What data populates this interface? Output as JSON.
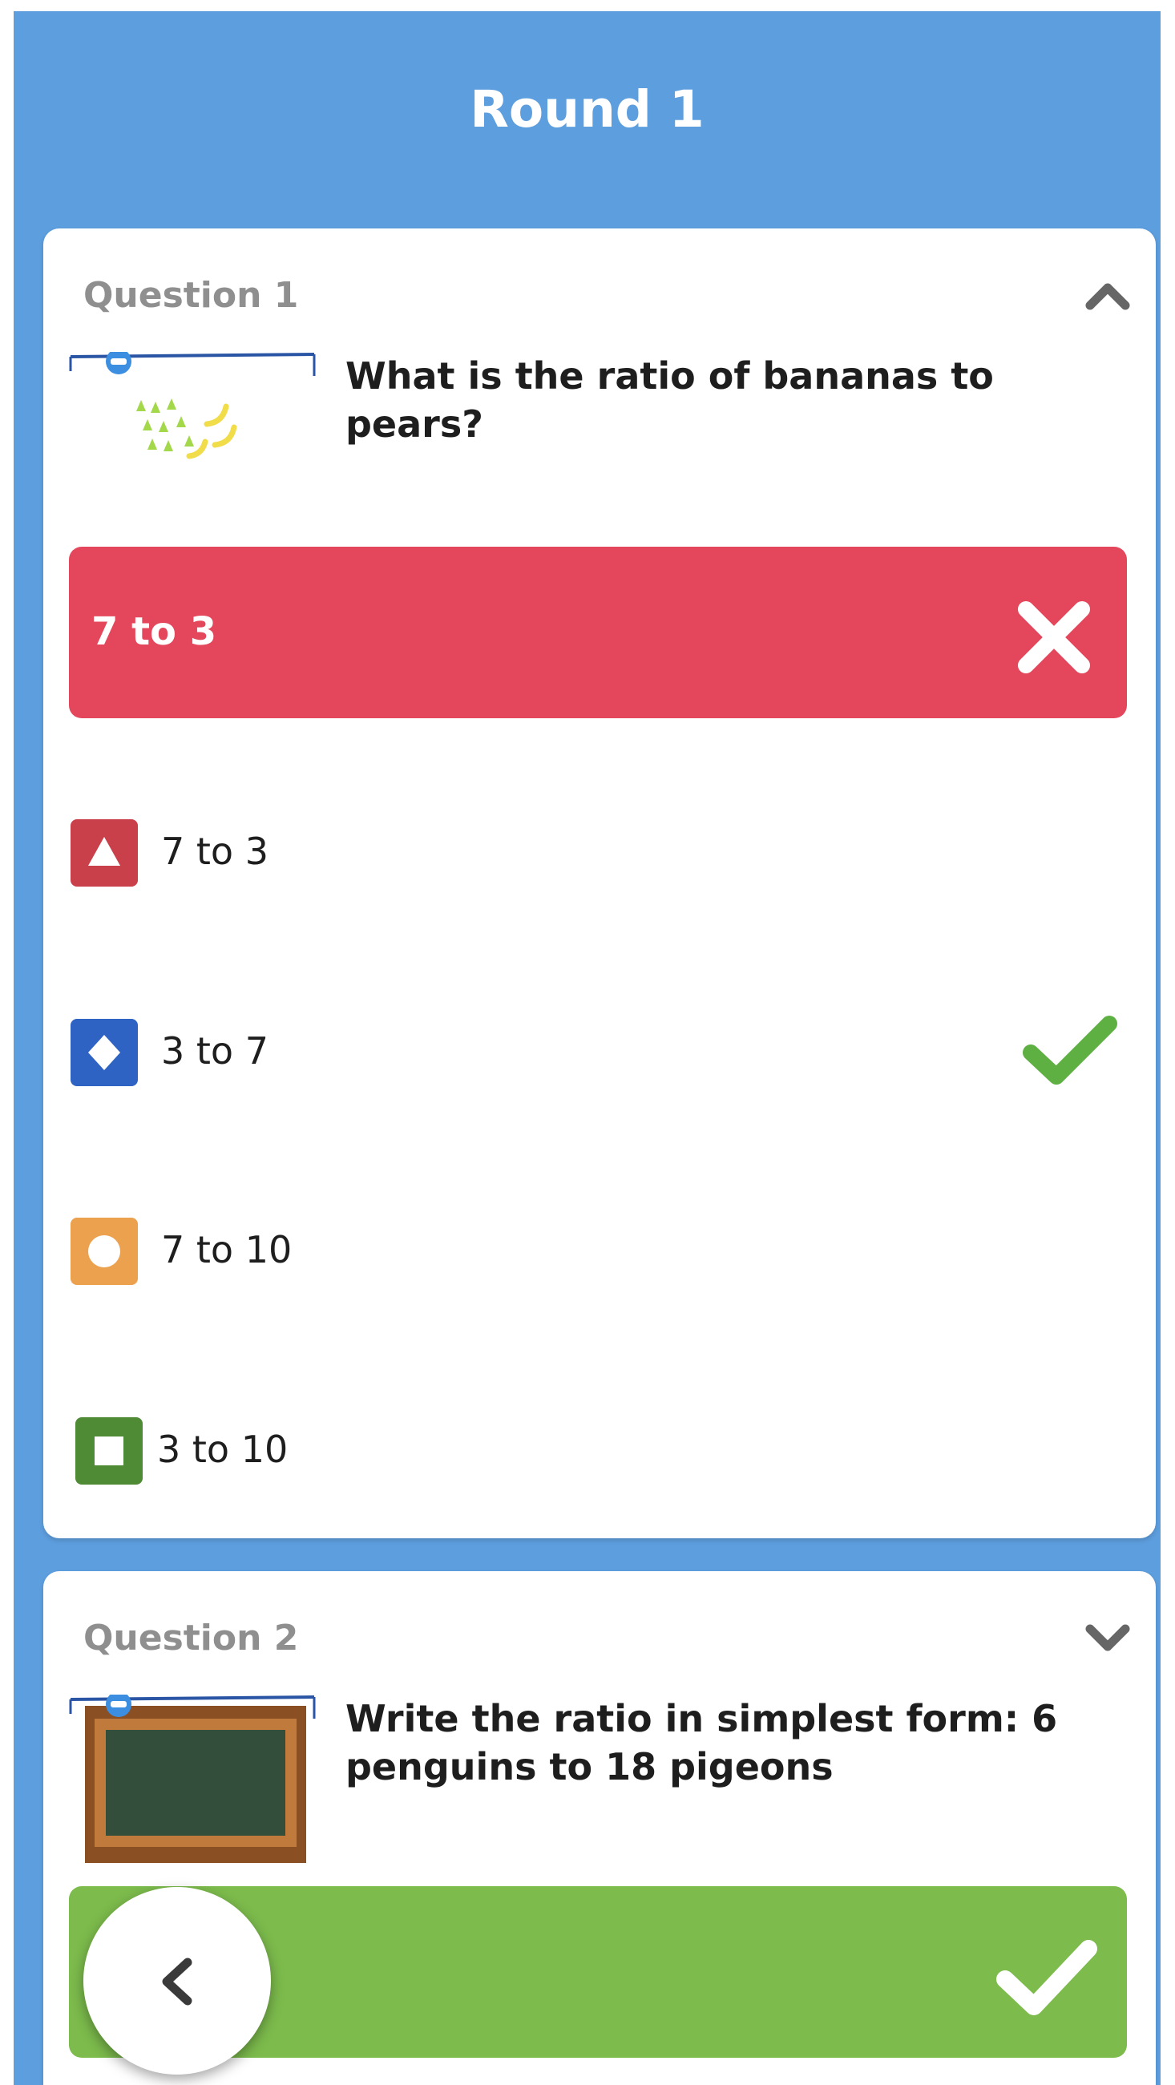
{
  "header": {
    "title": "Round 1"
  },
  "questions": [
    {
      "label": "Question 1",
      "expanded": true,
      "chevron_icon": "chevron-up-icon",
      "text": "What is the ratio of bananas to pears?",
      "thumbnail": "fruit-thumbnail",
      "player_answer": {
        "text": "7 to 3",
        "correct": false,
        "color": "#e4465b",
        "icon": "cross-icon"
      },
      "options": [
        {
          "text": "7 to 3",
          "shape": "triangle-icon",
          "color": "#c9404a",
          "correct": false
        },
        {
          "text": "3 to 7",
          "shape": "diamond-icon",
          "color": "#2e63c3",
          "correct": true
        },
        {
          "text": "7 to 10",
          "shape": "circle-icon",
          "color": "#eca14f",
          "correct": false
        },
        {
          "text": "3 to 10",
          "shape": "square-icon",
          "color": "#4f8b35",
          "correct": false
        }
      ],
      "correct_icon": "check-icon",
      "correct_color": "#5fb043"
    },
    {
      "label": "Question 2",
      "expanded": false,
      "chevron_icon": "chevron-down-icon",
      "text": "Write the ratio in simplest form: 6 penguins to 18 pigeons",
      "thumbnail": "chalkboard-thumbnail",
      "player_answer": {
        "text": "",
        "correct": true,
        "color": "#7cbb4c",
        "icon": "check-icon"
      }
    }
  ],
  "back_button": {
    "icon": "chevron-left-icon"
  },
  "colors": {
    "header_bg": "#5d9ede",
    "card_bg": "#ffffff"
  }
}
